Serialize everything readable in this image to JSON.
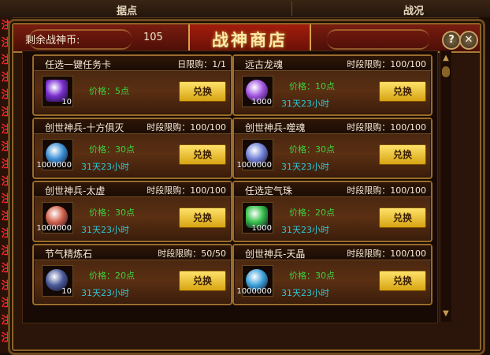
{
  "top_tabs": {
    "left": "据点",
    "right": "战况"
  },
  "left_strip_chars": [
    "注",
    "注",
    "注",
    "注",
    "注",
    "注",
    "注",
    "注",
    "注",
    "注",
    "注",
    "注",
    "注",
    "注",
    "注",
    "注",
    "注",
    "注",
    "注"
  ],
  "right_strip_text": [
    "(",
    "(",
    "(",
    "(",
    "(",
    "(",
    "(",
    "(",
    "(",
    "(",
    "(",
    "(",
    "(",
    "(",
    "(",
    "(",
    "(",
    "(",
    "(",
    "(",
    "(",
    "(",
    "("
  ],
  "window": {
    "title": "战神商店",
    "help_label": "?",
    "close_label": "✕"
  },
  "coins": {
    "label": "剩余战神币:",
    "value": "105"
  },
  "items": [
    {
      "name": "任选一键任务卡",
      "limit": "日限购：1/1",
      "count": "10",
      "price": "价格：5点",
      "timer": "",
      "button": "兑换",
      "icon": "task-card-icon",
      "icon_color": "#7a2fd0"
    },
    {
      "name": "远古龙魂",
      "limit": "时段限购：100/100",
      "count": "1000",
      "price": "价格：10点",
      "timer": "31天23小时",
      "button": "兑换",
      "icon": "dragon-soul-icon",
      "icon_color": "#a052e0"
    },
    {
      "name": "创世神兵-十方俱灭",
      "limit": "时段限购：100/100",
      "count": "1000000",
      "price": "价格：30点",
      "timer": "31天23小时",
      "button": "兑换",
      "icon": "orb-icon",
      "icon_color": "#3a8fd4"
    },
    {
      "name": "创世神兵-噬魂",
      "limit": "时段限购：100/100",
      "count": "1000000",
      "price": "价格：30点",
      "timer": "31天23小时",
      "button": "兑换",
      "icon": "orb-icon",
      "icon_color": "#6f80d6"
    },
    {
      "name": "创世神兵-太虚",
      "limit": "时段限购：100/100",
      "count": "1000000",
      "price": "价格：30点",
      "timer": "31天23小时",
      "button": "兑换",
      "icon": "orb-icon",
      "icon_color": "#d0604a"
    },
    {
      "name": "任选定气珠",
      "limit": "时段限购：100/100",
      "count": "1000",
      "price": "价格：20点",
      "timer": "31天23小时",
      "button": "兑换",
      "icon": "gem-icon",
      "icon_color": "#36c04a"
    },
    {
      "name": "节气精炼石",
      "limit": "时段限购：50/50",
      "count": "10",
      "price": "价格：20点",
      "timer": "31天23小时",
      "button": "兑换",
      "icon": "stone-icon",
      "icon_color": "#4a5a9a"
    },
    {
      "name": "创世神兵-天晶",
      "limit": "时段限购：100/100",
      "count": "1000000",
      "price": "价格：30点",
      "timer": "31天23小时",
      "button": "兑换",
      "icon": "orb-icon",
      "icon_color": "#3aa0d8"
    }
  ],
  "scrollbar": {
    "up": "▲",
    "down": "▼"
  }
}
